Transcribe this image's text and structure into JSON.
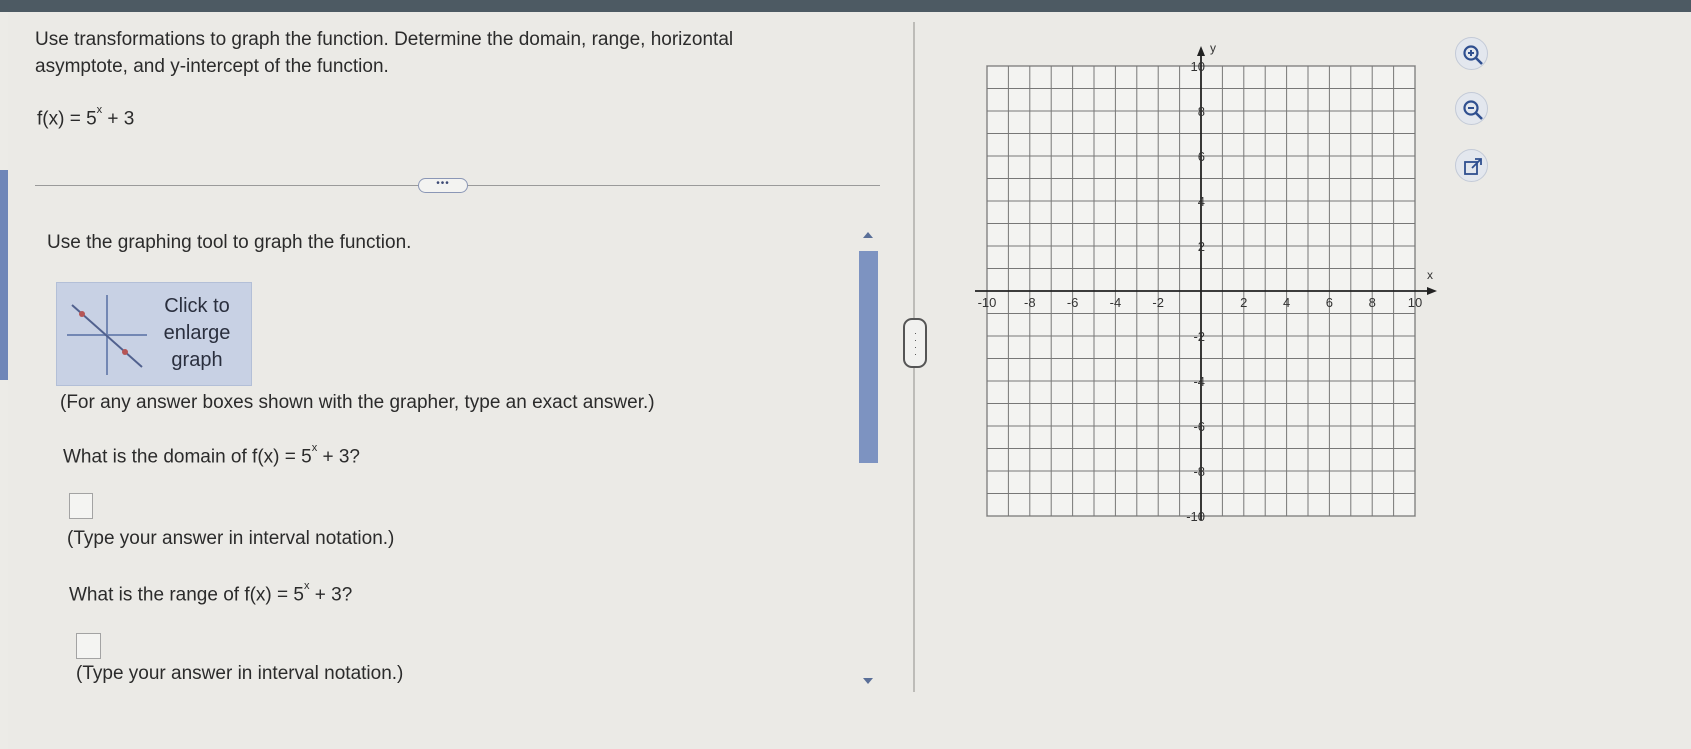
{
  "question": {
    "text": "Use transformations to graph the function. Determine the domain, range, horizontal asymptote, and y-intercept of the function.",
    "function_prefix": "f(x) = 5",
    "function_exponent": "x",
    "function_suffix": " + 3"
  },
  "more_button_label": "•••",
  "instructions": "Use the graphing tool to graph the function.",
  "enlarge_button": {
    "line1": "Click to",
    "line2": "enlarge",
    "line3": "graph"
  },
  "note": "(For any answer boxes shown with the grapher, type an exact answer.)",
  "domain": {
    "question_prefix": "What is the domain of f(x) = 5",
    "question_exponent": "x",
    "question_suffix": " + 3?",
    "value": "",
    "hint": "(Type your answer in interval notation.)"
  },
  "range": {
    "question_prefix": "What is the range of f(x) = 5",
    "question_exponent": "x",
    "question_suffix": " + 3?",
    "value": "",
    "hint": "(Type your answer in interval notation.)"
  },
  "graph": {
    "x_axis_label": "x",
    "y_axis_label": "y",
    "x_min": -10,
    "x_max": 10,
    "y_min": -10,
    "y_max": 10,
    "x_tick_labels": [
      "-10",
      "-8",
      "-6",
      "-4",
      "-2",
      "2",
      "4",
      "6",
      "8",
      "10"
    ],
    "y_tick_labels": [
      "10",
      "8",
      "6",
      "4",
      "2",
      "-2",
      "-4",
      "-6",
      "-8",
      "-10"
    ]
  },
  "tools": [
    {
      "name": "zoom-in-icon"
    },
    {
      "name": "zoom-out-icon"
    },
    {
      "name": "pop-out-icon"
    }
  ],
  "colors": {
    "accent": "#2f4f8f",
    "scrollbar": "#7d93c1",
    "button_bg": "#c8d1e4"
  }
}
